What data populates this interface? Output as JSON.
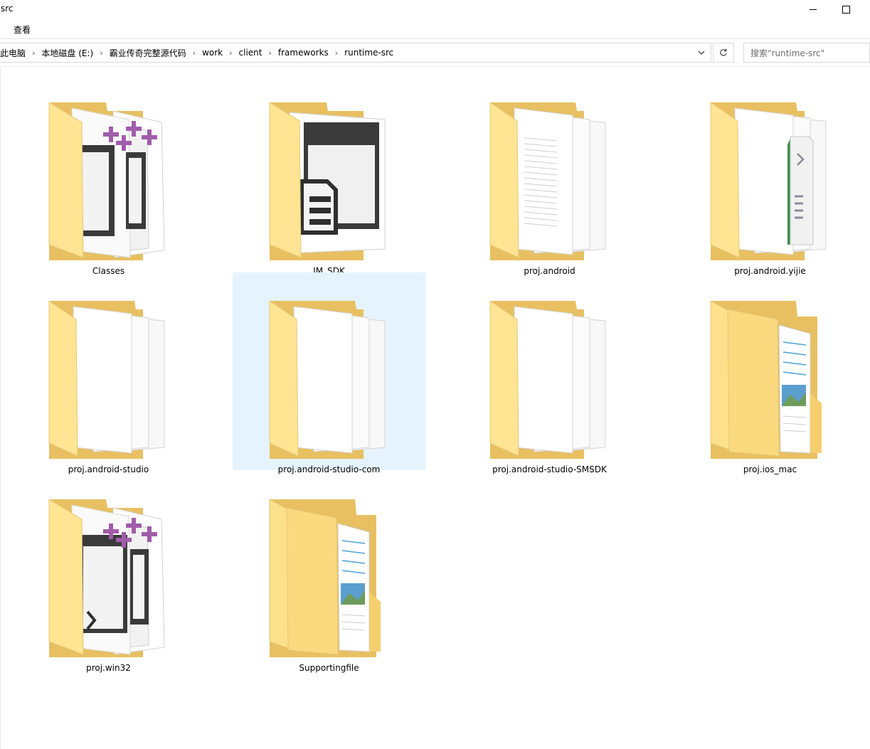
{
  "window": {
    "title": "src"
  },
  "ribbon": {
    "tab_view": "查看"
  },
  "address": {
    "crumbs": [
      "此电脑",
      "本地磁盘 (E:)",
      "霸业传奇完整源代码",
      "work",
      "client",
      "frameworks",
      "runtime-src"
    ],
    "refresh_icon": "refresh-icon",
    "dropdown_icon": "chevron-down-icon"
  },
  "search": {
    "placeholder": "搜索\"runtime-src\""
  },
  "folders": [
    {
      "name": "Classes",
      "icon": "folder-cpp-icon"
    },
    {
      "name": "IM_SDK",
      "icon": "folder-window-doc-icon"
    },
    {
      "name": "proj.android",
      "icon": "folder-pages-icon"
    },
    {
      "name": "proj.android.yijie",
      "icon": "folder-script-icon"
    },
    {
      "name": "proj.android-studio",
      "icon": "folder-pages-icon"
    },
    {
      "name": "proj.android-studio-com",
      "icon": "folder-pages-icon",
      "selected": true
    },
    {
      "name": "proj.android-studio-SMSDK",
      "icon": "folder-pages-icon"
    },
    {
      "name": "proj.ios_mac",
      "icon": "folder-open-doc-icon"
    },
    {
      "name": "proj.win32",
      "icon": "folder-cpp-icon"
    },
    {
      "name": "Supportingfile",
      "icon": "folder-open-doc-icon"
    }
  ],
  "colors": {
    "folder_back": "#e8c061",
    "folder_front": "#ffe493",
    "selection": "#e5f3fe",
    "cpp_purple": "#a05ca9"
  }
}
